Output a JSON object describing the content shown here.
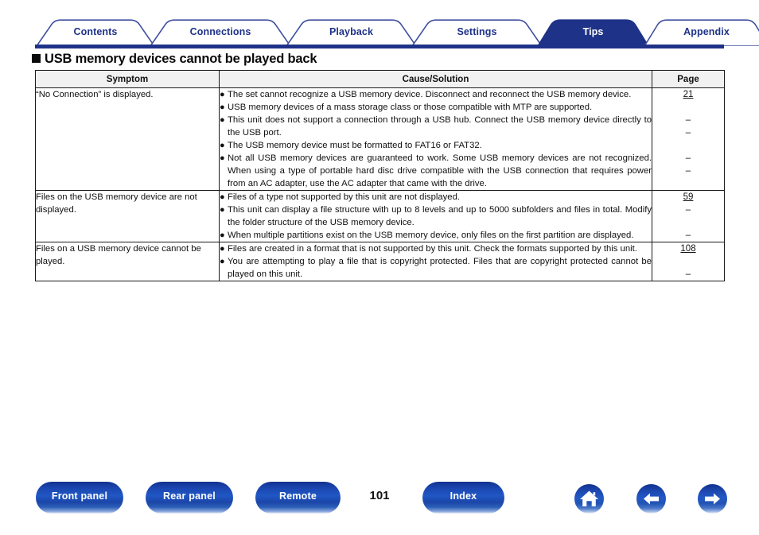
{
  "nav": {
    "tabs": [
      {
        "label": "Contents",
        "selected": false
      },
      {
        "label": "Connections",
        "selected": false
      },
      {
        "label": "Playback",
        "selected": false
      },
      {
        "label": "Settings",
        "selected": false
      },
      {
        "label": "Tips",
        "selected": true
      },
      {
        "label": "Appendix",
        "selected": false
      }
    ],
    "accent_color": "#1e3288",
    "selected_tab": "Tips"
  },
  "heading": {
    "bullet": "square",
    "text": "USB memory devices cannot be played back"
  },
  "table": {
    "headers": {
      "symptom": "Symptom",
      "cause": "Cause/Solution",
      "page": "Page"
    },
    "rows": [
      {
        "symptom": "“No Connection” is displayed.",
        "bullets": [
          {
            "text": "The set cannot recognize a USB memory device. Disconnect and reconnect the USB memory device.",
            "lines": 2,
            "page": "21",
            "page_is_link": true
          },
          {
            "text": "USB memory devices of a mass storage class or those compatible with MTP are supported.",
            "lines": 1,
            "page": "–",
            "page_is_link": false
          },
          {
            "text": "This unit does not support a connection through a USB hub. Connect the USB memory device directly to the USB port.",
            "lines": 2,
            "page": "–",
            "page_is_link": false
          },
          {
            "text": "The USB memory device must be formatted to FAT16 or FAT32.",
            "lines": 1,
            "page": "–",
            "page_is_link": false
          },
          {
            "text": "Not all USB memory devices are guaranteed to work. Some USB memory devices are not recognized. When using a type of portable hard disc drive compatible with the USB connection that requires power from an AC adapter, use the AC adapter that came with the drive.",
            "lines": 3,
            "page": "–",
            "page_is_link": false
          }
        ]
      },
      {
        "symptom": "Files on the USB memory device are not displayed.",
        "bullets": [
          {
            "text": "Files of a type not supported by this unit are not displayed.",
            "lines": 1,
            "page": "59",
            "page_is_link": true
          },
          {
            "text": "This unit can display a file structure with up to 8 levels and up to 5000 subfolders and files in total. Modify the folder structure of the USB memory device.",
            "lines": 2,
            "page": "–",
            "page_is_link": false
          },
          {
            "text": "When multiple partitions exist on the USB memory device, only files on the first partition are displayed.",
            "lines": 2,
            "page": "–",
            "page_is_link": false
          }
        ]
      },
      {
        "symptom": "Files on a USB memory device cannot be played.",
        "bullets": [
          {
            "text": "Files are created in a format that is not supported by this unit. Check the formats supported by this unit.",
            "lines": 2,
            "page": "108",
            "page_is_link": true
          },
          {
            "text": "You are attempting to play a file that is copyright protected. Files that are copyright protected cannot be played on this unit.",
            "lines": 2,
            "page": "–",
            "page_is_link": false
          }
        ]
      }
    ]
  },
  "footer": {
    "buttons": [
      {
        "label": "Front panel"
      },
      {
        "label": "Rear panel"
      },
      {
        "label": "Remote"
      },
      {
        "label": "Index"
      }
    ],
    "page_number": "101",
    "icons": [
      {
        "name": "home-icon",
        "glyph": "home"
      },
      {
        "name": "back-arrow-icon",
        "glyph": "left"
      },
      {
        "name": "next-arrow-icon",
        "glyph": "right"
      }
    ]
  }
}
